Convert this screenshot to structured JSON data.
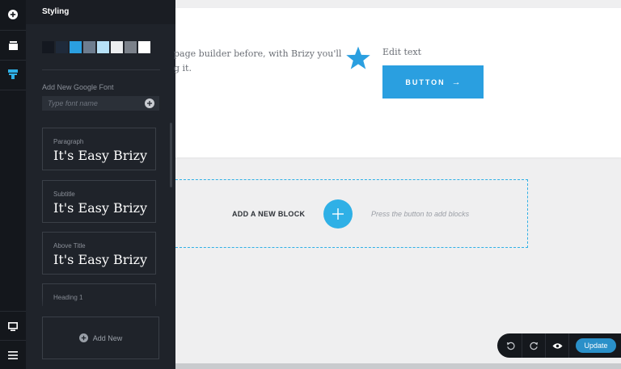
{
  "toolbar": {
    "icons": [
      "add-element-icon",
      "pages-icon",
      "styling-icon",
      "device-desktop-icon",
      "menu-icon"
    ],
    "accent": "#2fb0e6"
  },
  "panel": {
    "title": "Styling",
    "swatches": [
      "#141820",
      "#1f2a3a",
      "#2a9fe0",
      "#6e7d8f",
      "#b7e1f7",
      "#eceef0",
      "#7b818a",
      "#ffffff"
    ],
    "font": {
      "label": "Add New Google Font",
      "placeholder": "Type font name"
    },
    "typography": [
      {
        "label": "Paragraph",
        "sample": "It's Easy Brizy"
      },
      {
        "label": "Subtitle",
        "sample": "It's Easy Brizy"
      },
      {
        "label": "Above Title",
        "sample": "It's Easy Brizy"
      },
      {
        "label": "Heading 1",
        "sample": ""
      }
    ],
    "add_new": "Add New"
  },
  "content": {
    "text_line1": "page builder before, with Brizy you'll",
    "text_line2": "g it.",
    "edit_text": "Edit text",
    "button_label": "BUTTON",
    "button_arrow": "→"
  },
  "add_block": {
    "label": "ADD A NEW BLOCK",
    "hint": "Press the button to add blocks"
  },
  "controls": {
    "update": "Update"
  }
}
